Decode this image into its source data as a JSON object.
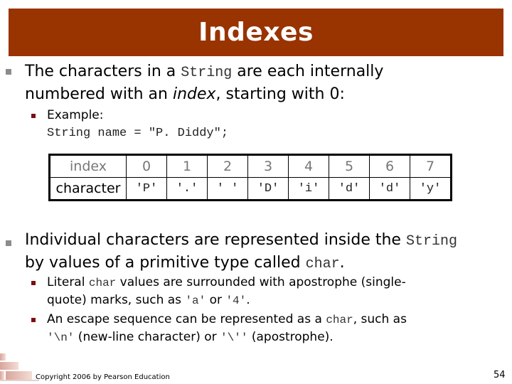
{
  "title": "Indexes",
  "bullets": [
    {
      "line1": [
        {
          "text": "The characters in a ",
          "style": "normal"
        },
        {
          "text": "String",
          "style": "mono"
        },
        {
          "text": " are each internally",
          "style": "normal"
        }
      ],
      "line2": [
        {
          "text": "numbered with an ",
          "style": "normal"
        },
        {
          "text": "index",
          "style": "italic"
        },
        {
          "text": ", starting with 0:",
          "style": "normal"
        }
      ],
      "sub": {
        "label": "Example:",
        "code": "String name = \"P. Diddy\";"
      }
    },
    {
      "line1": [
        {
          "text": "Individual characters are represented inside the ",
          "style": "normal"
        },
        {
          "text": "String",
          "style": "mono"
        }
      ],
      "line2": [
        {
          "text": "by values of a primitive type called ",
          "style": "normal"
        },
        {
          "text": "char",
          "style": "mono"
        },
        {
          "text": ".",
          "style": "normal"
        }
      ],
      "subs": [
        {
          "line1": [
            {
              "text": "Literal ",
              "style": "normal"
            },
            {
              "text": "char",
              "style": "mono"
            },
            {
              "text": " values are surrounded with apostrophe (single-",
              "style": "normal"
            }
          ],
          "line2": [
            {
              "text": "quote) marks, such as ",
              "style": "normal"
            },
            {
              "text": "'a'",
              "style": "mono"
            },
            {
              "text": " or ",
              "style": "normal"
            },
            {
              "text": "'4'",
              "style": "mono"
            },
            {
              "text": ".",
              "style": "normal"
            }
          ]
        },
        {
          "line1": [
            {
              "text": "An escape sequence can be represented as a ",
              "style": "normal"
            },
            {
              "text": "char",
              "style": "mono"
            },
            {
              "text": ", such as",
              "style": "normal"
            }
          ],
          "line2": [
            {
              "text": "'\\n'",
              "style": "mono"
            },
            {
              "text": " (new-line character) or ",
              "style": "normal"
            },
            {
              "text": "'\\''",
              "style": "mono"
            },
            {
              "text": " (apostrophe).",
              "style": "normal"
            }
          ]
        }
      ]
    }
  ],
  "table": {
    "row_labels": {
      "index": "index",
      "character": "character"
    },
    "indexes": [
      "0",
      "1",
      "2",
      "3",
      "4",
      "5",
      "6",
      "7"
    ],
    "characters": [
      "'P'",
      "'.'",
      "' '",
      "'D'",
      "'i'",
      "'d'",
      "'d'",
      "'y'"
    ]
  },
  "footer": {
    "copyright": "Copyright 2006 by Pearson Education",
    "page_number": "54"
  },
  "colors": {
    "title_bar": "#993300",
    "bullet_level1": "#8c8c8c",
    "bullet_level2": "#7a1010"
  }
}
